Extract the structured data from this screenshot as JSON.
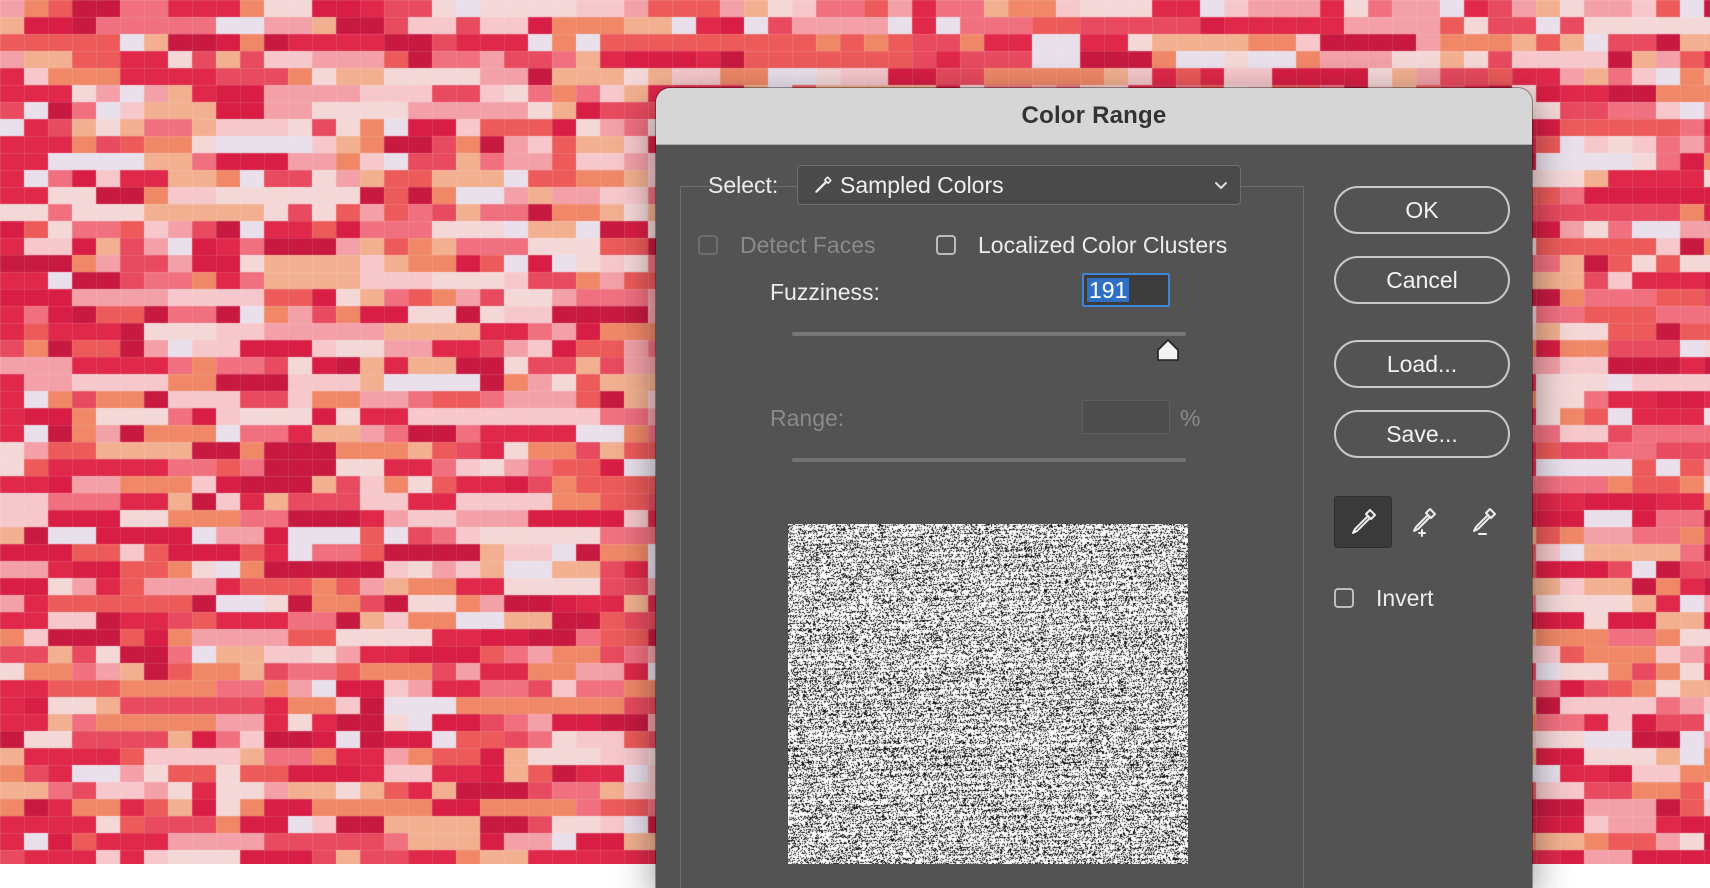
{
  "dialog": {
    "title": "Color Range",
    "select_label": "Select:",
    "select_value": "Sampled Colors",
    "detect_faces_label": "Detect Faces",
    "detect_faces_checked": false,
    "localized_clusters_label": "Localized Color Clusters",
    "localized_clusters_checked": false,
    "fuzziness_label": "Fuzziness:",
    "fuzziness_value": "191",
    "fuzziness_slider_fraction": 0.955,
    "range_label": "Range:",
    "range_value": "",
    "range_unit": "%",
    "buttons": {
      "ok": "OK",
      "cancel": "Cancel",
      "load": "Load...",
      "save": "Save..."
    },
    "tools": [
      {
        "name": "eyedropper-icon",
        "selected": true
      },
      {
        "name": "eyedropper-plus-icon",
        "selected": false
      },
      {
        "name": "eyedropper-minus-icon",
        "selected": false
      }
    ],
    "invert_label": "Invert",
    "invert_checked": false
  },
  "colors": {
    "dialog_bg": "#535353",
    "titlebar_bg": "#d6d6d6",
    "focus_blue": "#3d85d6",
    "canvas_palette": [
      "#e0284a",
      "#e84a5f",
      "#f07080",
      "#f3a0a8",
      "#f6c8cc",
      "#d81e44",
      "#ec5a5a",
      "#f2b090",
      "#f4d8d8",
      "#e9e0ec",
      "#c81a40",
      "#f08868"
    ]
  }
}
